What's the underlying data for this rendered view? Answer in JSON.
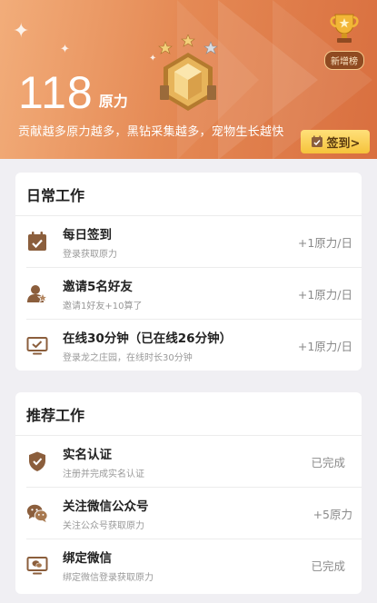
{
  "hero": {
    "points_value": "118",
    "points_unit": "原力",
    "slogan": "贡献越多原力越多，黑钻采集越多，宠物生长越快",
    "rank_label": "新增榜",
    "signin_label": "签到>"
  },
  "daily": {
    "title": "日常工作",
    "items": [
      {
        "icon": "calendar-check-icon",
        "title": "每日签到",
        "desc": "登录获取原力",
        "reward": "+1原力/日"
      },
      {
        "icon": "user-star-icon",
        "title": "邀请5名好友",
        "desc": "邀请1好友+10算了",
        "reward": "+1原力/日"
      },
      {
        "icon": "monitor-check-icon",
        "title": "在线30分钟（已在线26分钟）",
        "desc": "登录龙之庄园，在线时长30分钟",
        "reward": "+1原力/日"
      }
    ]
  },
  "recommended": {
    "title": "推荐工作",
    "items": [
      {
        "icon": "shield-check-icon",
        "title": "实名认证",
        "desc": "注册并完成实名认证",
        "reward": "已完成"
      },
      {
        "icon": "wechat-icon",
        "title": "关注微信公众号",
        "desc": "关注公众号获取原力",
        "reward": "+5原力"
      },
      {
        "icon": "monitor-wechat-icon",
        "title": "绑定微信",
        "desc": "绑定微信登录获取原力",
        "reward": "已完成"
      }
    ]
  },
  "colors": {
    "accent": "#e58a55",
    "icon_brown": "#8b5e3c",
    "button_yellow": "#f5c33b"
  }
}
